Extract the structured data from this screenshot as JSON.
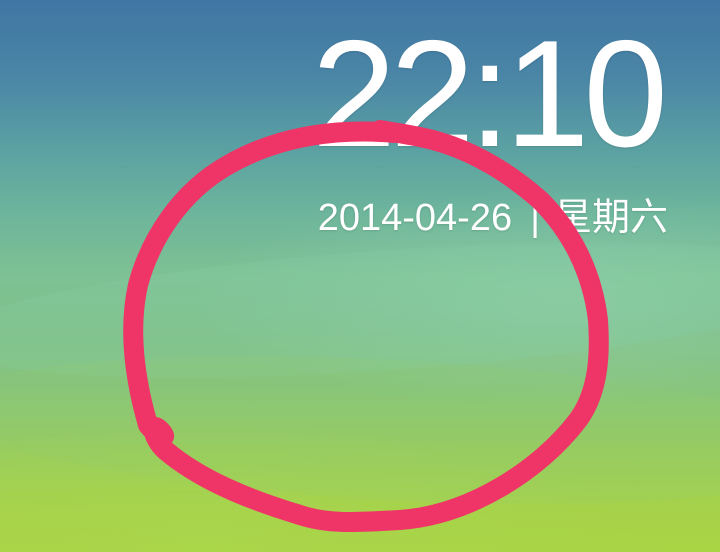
{
  "lock_screen": {
    "time": "22:10",
    "date": "2014-04-26",
    "separator": "|",
    "weekday": "星期六"
  },
  "annotation": {
    "shape": "hand-drawn-circle",
    "color": "#ef3567"
  },
  "wallpaper": {
    "top_color": "#3f76a3",
    "middle_color": "#7ec193",
    "bottom_color": "#a9d444"
  }
}
